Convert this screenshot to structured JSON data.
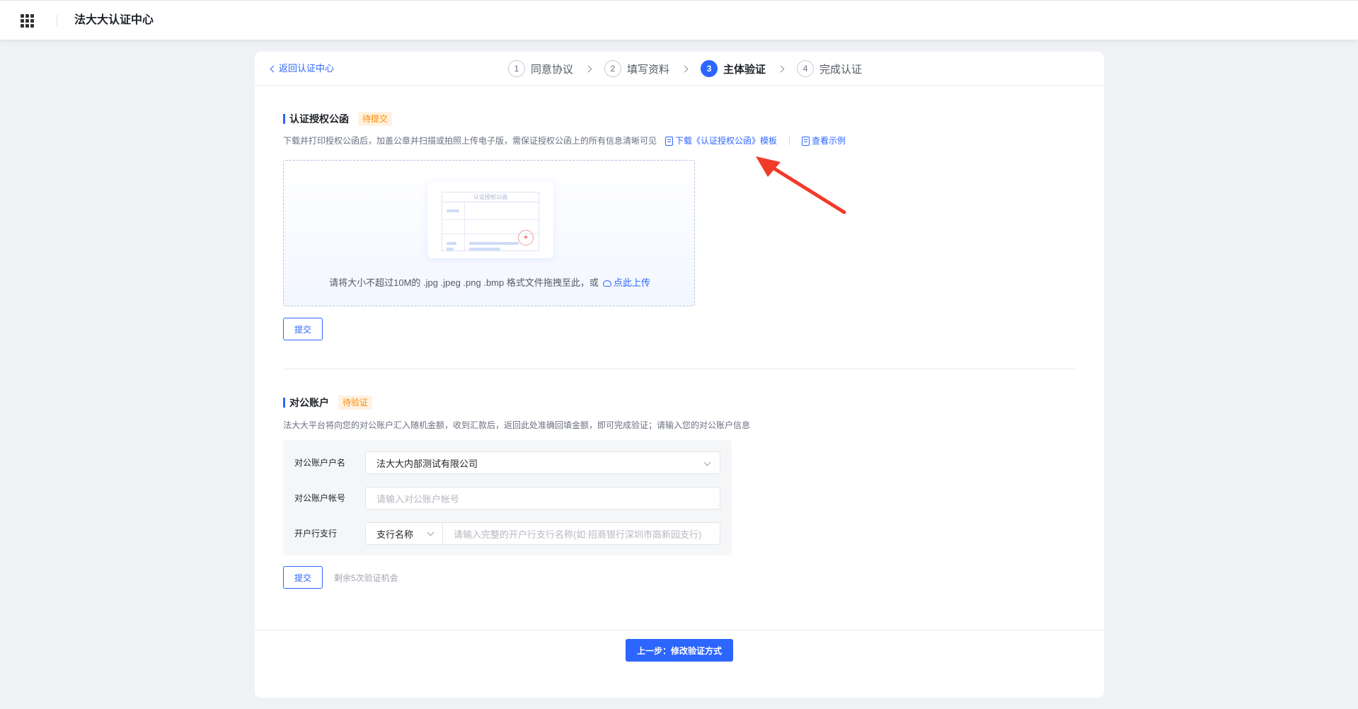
{
  "app": {
    "title": "法大大认证中心",
    "apps_icon": "grid-icon"
  },
  "nav": {
    "back_label": "返回认证中心"
  },
  "steps": [
    {
      "num": "1",
      "label": "同意协议",
      "active": false
    },
    {
      "num": "2",
      "label": "填写资料",
      "active": false
    },
    {
      "num": "3",
      "label": "主体验证",
      "active": true
    },
    {
      "num": "4",
      "label": "完成认证",
      "active": false
    }
  ],
  "auth_letter": {
    "title": "认证授权公函",
    "badge": "待提交",
    "description": "下载并打印授权公函后，加盖公章并扫描或拍照上传电子版，需保证授权公函上的所有信息清晰可见",
    "download_link": "下载《认证授权公函》模板",
    "example_link": "查看示例",
    "illustration_title": "认证授权公函",
    "stamp_glyph": "★",
    "upload_hint": "请将大小不超过10M的 .jpg .jpeg .png .bmp 格式文件拖拽至此，或",
    "upload_link": "点此上传",
    "submit_label": "提交"
  },
  "bank_account": {
    "title": "对公账户",
    "badge": "待验证",
    "description": "法大大平台将向您的对公账户汇入随机金额，收到汇款后，返回此处准确回填金额，即可完成验证；请输入您的对公账户信息",
    "account_name_label": "对公账户户名",
    "account_name_value": "法大大内部测试有限公司",
    "account_number_label": "对公账户帐号",
    "account_number_placeholder": "请输入对公账户帐号",
    "branch_label": "开户行支行",
    "branch_select_value": "支行名称",
    "branch_placeholder": "请输入完整的开户行支行名称(如:招商银行深圳市高新园支行)",
    "submit_label": "提交",
    "remaining_text": "剩余5次验证机会"
  },
  "footer": {
    "prev_label": "上一步：修改验证方式"
  },
  "colors": {
    "primary": "#2c66ff",
    "badge_bg": "#fff2e2",
    "badge_text": "#ff8a00",
    "annotation_arrow": "#f23a2a"
  }
}
